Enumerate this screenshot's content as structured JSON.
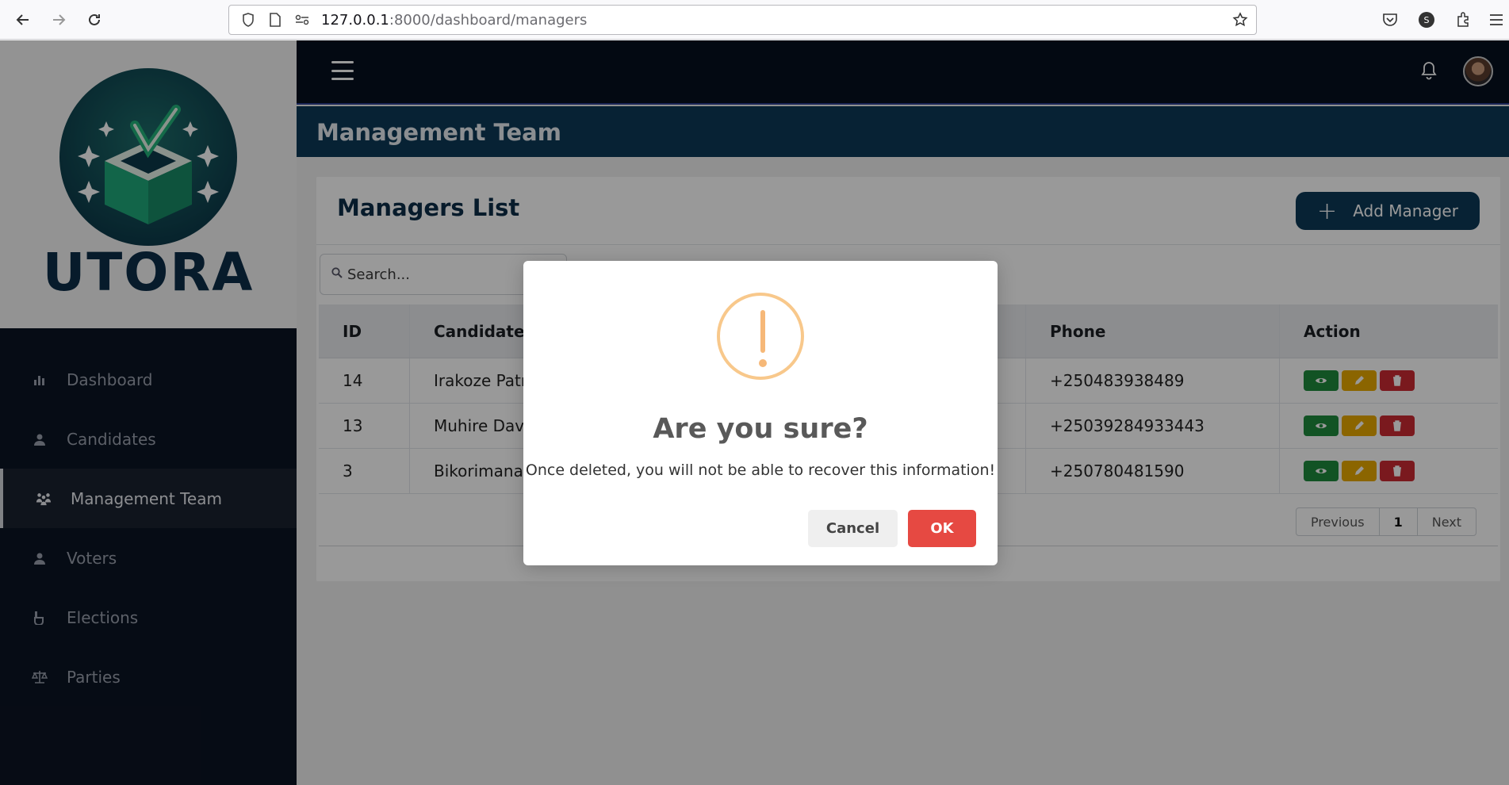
{
  "browser": {
    "url_host": "127.0.0.1",
    "url_path": ":8000/dashboard/managers"
  },
  "sidebar": {
    "logo_text": "UTORA",
    "items": [
      {
        "label": "Dashboard",
        "icon": "bar-chart-icon"
      },
      {
        "label": "Candidates",
        "icon": "user-icon"
      },
      {
        "label": "Management Team",
        "icon": "team-icon",
        "active": true
      },
      {
        "label": "Voters",
        "icon": "user-icon"
      },
      {
        "label": "Elections",
        "icon": "ballot-hand-icon"
      },
      {
        "label": "Parties",
        "icon": "scales-icon"
      }
    ]
  },
  "header": {
    "page_title": "Management Team"
  },
  "card": {
    "title": "Managers List",
    "add_label": "Add Manager",
    "search_placeholder": "Search..."
  },
  "table": {
    "headers": [
      "ID",
      "Candidate",
      "Phone",
      "Action"
    ],
    "rows": [
      {
        "id": "14",
        "candidate": "Irakoze Patri",
        "phone": "+250483938489"
      },
      {
        "id": "13",
        "candidate": "Muhire David",
        "phone": "+25039284933443"
      },
      {
        "id": "3",
        "candidate": "Bikorimana S",
        "phone": "+250780481590"
      }
    ]
  },
  "pager": {
    "previous": "Previous",
    "current": "1",
    "next": "Next"
  },
  "modal": {
    "title": "Are you sure?",
    "text": "Once deleted, you will not be able to recover this information!",
    "cancel": "Cancel",
    "ok": "OK"
  },
  "colors": {
    "primary": "#0d3a58",
    "sidebar_bg": "#0b1423",
    "ok_button": "#e64942",
    "warning": "#f8c88b"
  }
}
